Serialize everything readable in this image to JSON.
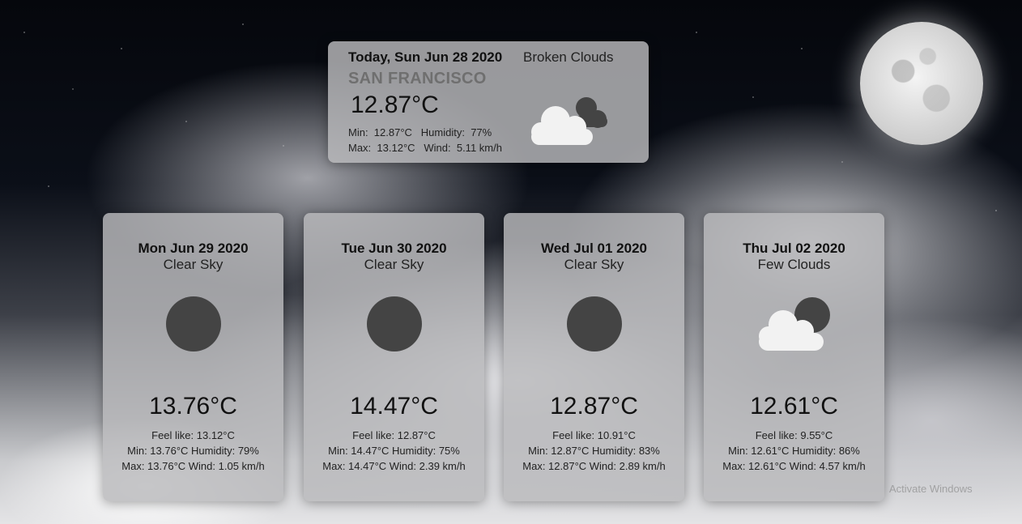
{
  "today": {
    "date": "Today, Sun Jun 28 2020",
    "description": "Broken Clouds",
    "city": "SAN FRANCISCO",
    "temperature": "12.87°C",
    "min_label": "Min:",
    "min": "12.87°C",
    "humidity_label": "Humidity:",
    "humidity": "77%",
    "max_label": "Max:",
    "max": "13.12°C",
    "wind_label": "Wind:",
    "wind": "5.11 km/h",
    "icon": "broken-clouds-icon"
  },
  "forecast": [
    {
      "date": "Mon Jun 29 2020",
      "description": "Clear Sky",
      "icon": "sun-icon",
      "temperature": "13.76°C",
      "feels_like": "Feel like: 13.12°C",
      "min_humidity": "Min: 13.76°C  Humidity: 79%",
      "max_wind": "Max: 13.76°C  Wind: 1.05 km/h"
    },
    {
      "date": "Tue Jun 30 2020",
      "description": "Clear Sky",
      "icon": "sun-icon",
      "temperature": "14.47°C",
      "feels_like": "Feel like: 12.87°C",
      "min_humidity": "Min: 14.47°C  Humidity: 75%",
      "max_wind": "Max: 14.47°C  Wind: 2.39 km/h"
    },
    {
      "date": "Wed Jul 01 2020",
      "description": "Clear Sky",
      "icon": "sun-icon",
      "temperature": "12.87°C",
      "feels_like": "Feel like: 10.91°C",
      "min_humidity": "Min: 12.87°C  Humidity: 83%",
      "max_wind": "Max: 12.87°C  Wind: 2.89 km/h"
    },
    {
      "date": "Thu Jul 02 2020",
      "description": "Few Clouds",
      "icon": "few-clouds-icon",
      "temperature": "12.61°C",
      "feels_like": "Feel like: 9.55°C",
      "min_humidity": "Min: 12.61°C  Humidity: 86%",
      "max_wind": "Max: 12.61°C  Wind: 4.57 km/h"
    }
  ],
  "watermark": "Activate Windows",
  "colors": {
    "icon_dark": "#444444",
    "cloud_white": "#f2f2f2"
  }
}
